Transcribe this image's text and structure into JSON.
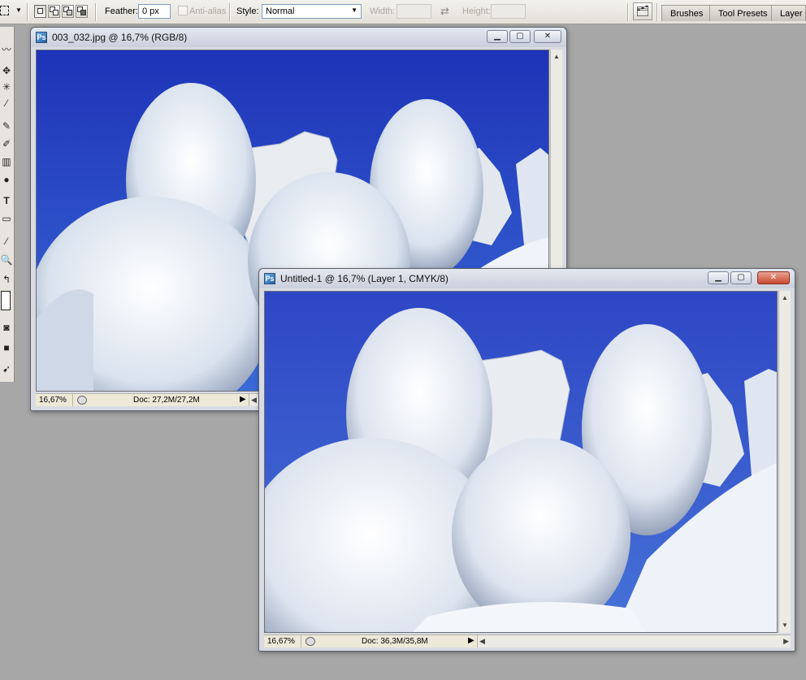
{
  "options_bar": {
    "feather_label": "Feather:",
    "feather_value": "0 px",
    "anti_alias_label": "Anti-alias",
    "style_label": "Style:",
    "style_value": "Normal",
    "width_label": "Width:",
    "height_label": "Height:"
  },
  "palette_well": {
    "tabs": [
      "Brushes",
      "Tool Presets",
      "Layer Co"
    ]
  },
  "windows": [
    {
      "title": "003_032.jpg @ 16,7% (RGB/8)",
      "zoom": "16,67%",
      "doc_size": "Doc: 27,2M/27,2M"
    },
    {
      "title": "Untitled-1 @ 16,7% (Layer 1, CMYK/8)",
      "zoom": "16,67%",
      "doc_size": "Doc: 36,3M/35,8M"
    }
  ],
  "colors": {
    "sky": "#2b46c7",
    "workspace": "#a7a7a7"
  }
}
